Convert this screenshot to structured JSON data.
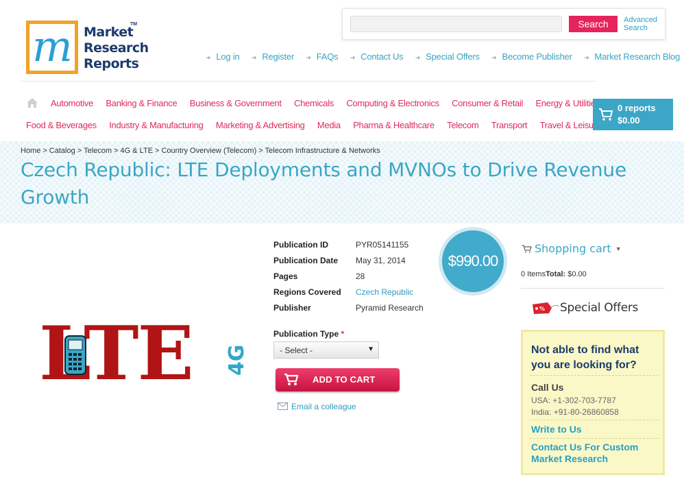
{
  "logo": {
    "letters": "m",
    "text_line1": "Market",
    "text_line2": "Research",
    "text_line3": "Reports",
    "tm": "TM"
  },
  "search": {
    "value": "",
    "button_label": "Search",
    "advanced_line1": "Advanced",
    "advanced_line2": "Search"
  },
  "top_nav": [
    "Log in",
    "Register",
    "FAQs",
    "Contact Us",
    "Special Offers",
    "Become Publisher",
    "Market Research Blog"
  ],
  "categories_row1": [
    "Automotive",
    "Banking & Finance",
    "Business & Government",
    "Chemicals",
    "Computing & Electronics",
    "Consumer & Retail",
    "Energy & Utilities"
  ],
  "categories_row2": [
    "Food & Beverages",
    "Industry & Manufacturing",
    "Marketing & Advertising",
    "Media",
    "Pharma & Healthcare",
    "Telecom",
    "Transport",
    "Travel & Leisure"
  ],
  "cart_button": {
    "reports": "0 reports",
    "amount": "$0.00"
  },
  "breadcrumb": [
    "Home",
    "Catalog",
    "Telecom",
    "4G & LTE",
    "Country Overview (Telecom)",
    "Telecom Infrastructure & Networks"
  ],
  "page_title": "Czech Republic: LTE Deployments and MVNOs to Drive Revenue Growth",
  "product_image": {
    "text": "LTE",
    "badge": "4G"
  },
  "details": {
    "pub_id_label": "Publication ID",
    "pub_id": "PYR05141155",
    "pub_date_label": "Publication Date",
    "pub_date": "May 31, 2014",
    "pages_label": "Pages",
    "pages": "28",
    "regions_label": "Regions Covered",
    "regions": "Czech Republic",
    "publisher_label": "Publisher",
    "publisher": "Pyramid Research"
  },
  "price": "$990.00",
  "publication_type": {
    "label": "Publication Type",
    "required_mark": "*",
    "selected": "- Select -"
  },
  "add_to_cart_label": "ADD TO CART",
  "email_colleague_label": "Email a colleague",
  "sidebar": {
    "shopping_cart_title": "Shopping cart",
    "items_text": "0 Items",
    "total_label": "Total:",
    "total_value": " $0.00",
    "special_offers": "Special Offers",
    "help_question": "Not able to find what you are looking for?",
    "call_us": "Call Us",
    "usa_phone": "USA: +1-302-703-7787",
    "india_phone": "India: +91-80-26860858",
    "write_to_us": "Write to Us",
    "custom_research": "Contact Us For Custom Market Research"
  },
  "colors": {
    "brand_blue": "#3ba6c6",
    "accent_pink": "#e02b5c",
    "logo_orange": "#f2a227",
    "logo_navy": "#1d3a6b",
    "help_bg": "#fbf8c8",
    "lte_red": "#b01414"
  },
  "icons": [
    "home-icon",
    "cart-icon",
    "basket-icon",
    "envelope-icon",
    "special-offer-tag-icon",
    "dropdown-caret-icon",
    "phone-icon"
  ]
}
